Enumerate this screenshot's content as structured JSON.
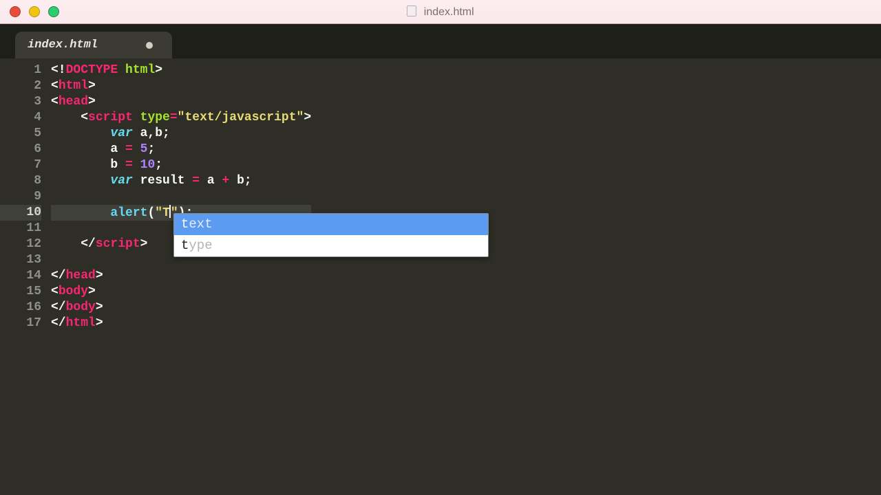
{
  "window": {
    "title": "index.html"
  },
  "tab": {
    "filename": "index.html",
    "dirty": true
  },
  "syntax_colors": {
    "punc": "#f8f8f2",
    "tag": "#f92672",
    "attr": "#a6e22e",
    "str": "#e6db74",
    "kw": "#66d9ef",
    "op": "#f92672",
    "num": "#ae81ff",
    "fn": "#66d9ef"
  },
  "editor": {
    "highlighted_line": 10,
    "lines": [
      {
        "n": 1,
        "tokens": [
          [
            "punc",
            "<!"
          ],
          [
            "tag",
            "DOCTYPE"
          ],
          [
            "punc",
            " "
          ],
          [
            "attr",
            "html"
          ],
          [
            "punc",
            ">"
          ]
        ]
      },
      {
        "n": 2,
        "tokens": [
          [
            "punc",
            "<"
          ],
          [
            "tag",
            "html"
          ],
          [
            "punc",
            ">"
          ]
        ]
      },
      {
        "n": 3,
        "tokens": [
          [
            "punc",
            "<"
          ],
          [
            "tag",
            "head"
          ],
          [
            "punc",
            ">"
          ]
        ]
      },
      {
        "n": 4,
        "tokens": [
          [
            "punc",
            "    <"
          ],
          [
            "tag",
            "script"
          ],
          [
            "punc",
            " "
          ],
          [
            "attr",
            "type"
          ],
          [
            "op",
            "="
          ],
          [
            "str",
            "\"text/javascript\""
          ],
          [
            "punc",
            ">"
          ]
        ]
      },
      {
        "n": 5,
        "tokens": [
          [
            "punc",
            "        "
          ],
          [
            "kw",
            "var"
          ],
          [
            "punc",
            " a,b;"
          ]
        ]
      },
      {
        "n": 6,
        "tokens": [
          [
            "punc",
            "        a "
          ],
          [
            "op",
            "="
          ],
          [
            "punc",
            " "
          ],
          [
            "num",
            "5"
          ],
          [
            "punc",
            ";"
          ]
        ]
      },
      {
        "n": 7,
        "tokens": [
          [
            "punc",
            "        b "
          ],
          [
            "op",
            "="
          ],
          [
            "punc",
            " "
          ],
          [
            "num",
            "10"
          ],
          [
            "punc",
            ";"
          ]
        ]
      },
      {
        "n": 8,
        "tokens": [
          [
            "punc",
            "        "
          ],
          [
            "kw",
            "var"
          ],
          [
            "punc",
            " result "
          ],
          [
            "op",
            "="
          ],
          [
            "punc",
            " a "
          ],
          [
            "op",
            "+"
          ],
          [
            "punc",
            " b;"
          ]
        ]
      },
      {
        "n": 9,
        "tokens": [
          [
            "punc",
            ""
          ]
        ]
      },
      {
        "n": 10,
        "tokens": [
          [
            "punc",
            "        "
          ],
          [
            "fn",
            "alert"
          ],
          [
            "punc",
            "("
          ],
          [
            "str",
            "\"T"
          ],
          [
            "caret",
            ""
          ],
          [
            "str",
            "\""
          ],
          [
            "punc",
            ");"
          ]
        ]
      },
      {
        "n": 11,
        "tokens": [
          [
            "punc",
            ""
          ]
        ]
      },
      {
        "n": 12,
        "tokens": [
          [
            "punc",
            "    </"
          ],
          [
            "tag",
            "script"
          ],
          [
            "punc",
            ">"
          ]
        ]
      },
      {
        "n": 13,
        "tokens": [
          [
            "punc",
            ""
          ]
        ]
      },
      {
        "n": 14,
        "tokens": [
          [
            "punc",
            "</"
          ],
          [
            "tag",
            "head"
          ],
          [
            "punc",
            ">"
          ]
        ]
      },
      {
        "n": 15,
        "tokens": [
          [
            "punc",
            "<"
          ],
          [
            "tag",
            "body"
          ],
          [
            "punc",
            ">"
          ]
        ]
      },
      {
        "n": 16,
        "tokens": [
          [
            "punc",
            "</"
          ],
          [
            "tag",
            "body"
          ],
          [
            "punc",
            ">"
          ]
        ]
      },
      {
        "n": 17,
        "tokens": [
          [
            "punc",
            "</"
          ],
          [
            "tag",
            "html"
          ],
          [
            "punc",
            ">"
          ]
        ]
      }
    ]
  },
  "autocomplete": {
    "typed": "t",
    "selected_index": 0,
    "items": [
      {
        "match": "t",
        "rest": "ext"
      },
      {
        "match": "t",
        "rest": "ype"
      }
    ]
  }
}
